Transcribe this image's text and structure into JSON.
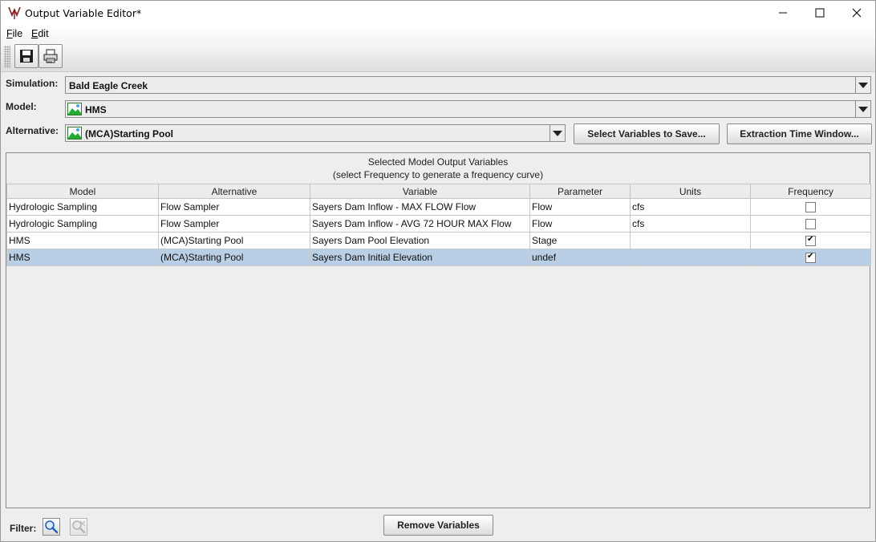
{
  "window": {
    "title": "Output Variable Editor*",
    "controls": [
      "minimize-icon",
      "maximize-icon",
      "close-icon"
    ]
  },
  "menu": [
    {
      "label": "File",
      "mnemonic": "F"
    },
    {
      "label": "Edit",
      "mnemonic": "E"
    }
  ],
  "toolbar": [
    "save-icon",
    "print-icon"
  ],
  "form": {
    "simulation_label": "Simulation:",
    "simulation_value": "Bald Eagle Creek",
    "model_label": "Model:",
    "model_value": "HMS",
    "alternative_label": "Alternative:",
    "alternative_value": "(MCA)Starting Pool",
    "select_variables_button": "Select Variables to Save...",
    "extraction_window_button": "Extraction Time Window..."
  },
  "table": {
    "title": "Selected Model Output Variables",
    "subtitle": "(select Frequency to generate a frequency curve)",
    "columns": [
      "Model",
      "Alternative",
      "Variable",
      "Parameter",
      "Units",
      "Frequency"
    ],
    "rows": [
      {
        "model": "Hydrologic Sampling",
        "alternative": "Flow Sampler",
        "variable": "Sayers Dam Inflow - MAX FLOW Flow",
        "parameter": "Flow",
        "units": "cfs",
        "frequency": false,
        "selected": false
      },
      {
        "model": "Hydrologic Sampling",
        "alternative": "Flow Sampler",
        "variable": "Sayers Dam Inflow - AVG 72 HOUR MAX Flow",
        "parameter": "Flow",
        "units": "cfs",
        "frequency": false,
        "selected": false
      },
      {
        "model": "HMS",
        "alternative": "(MCA)Starting Pool",
        "variable": "Sayers Dam Pool Elevation",
        "parameter": "Stage",
        "units": "",
        "frequency": true,
        "selected": false
      },
      {
        "model": "HMS",
        "alternative": "(MCA)Starting Pool",
        "variable": "Sayers Dam Initial Elevation",
        "parameter": "undef",
        "units": "",
        "frequency": true,
        "selected": true
      }
    ]
  },
  "bottom": {
    "filter_label": "Filter:",
    "remove_button": "Remove Variables"
  },
  "colors": {
    "selected_row": "#b8cfe5",
    "accent_icon": "#1f5fbf"
  }
}
